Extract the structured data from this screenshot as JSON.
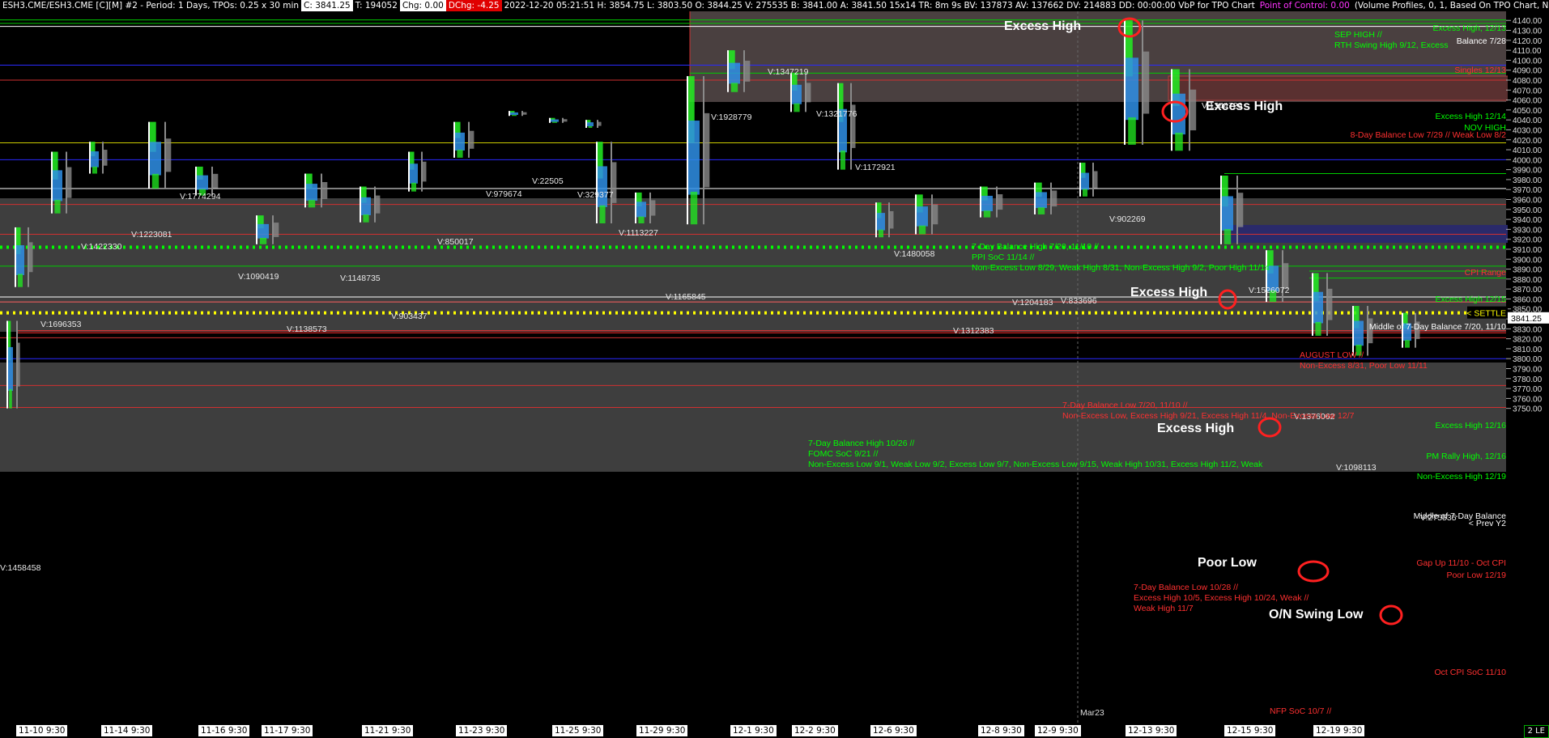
{
  "window_title": "ESH3.CME/ESH3.CME [C][M]",
  "topbar": {
    "items": [
      {
        "text": "ESH3.CME/ESH3.CME [C][M]  #2 - Period: 1 Days, TPOs: 0.25 x 30 min",
        "style": "plain"
      },
      {
        "text": "C: 3841.25",
        "style": "val"
      },
      {
        "text": "T: 194052",
        "style": "plain"
      },
      {
        "text": "Chg: 0.00",
        "style": "val"
      },
      {
        "text": "DChg: -4.25",
        "style": "neg"
      },
      {
        "text": "2022-12-20 05:21:51 H: 3854.75 L: 3803.50 O: 3844.25 V: 275535 B: 3841.00 A: 3841.50 15x14 TR: 8m 9s BV: 137873 AV: 137662 DV: 214883 DD: 00:00:00 VbP for TPO Chart",
        "style": "plain"
      },
      {
        "text": "Point of Control: 0.00",
        "style": "poc"
      },
      {
        "text": "(Volume Profiles, 0, 1, Based On TPO Chart, No, Days, 1, 50, 1",
        "style": "plain"
      }
    ]
  },
  "colors": {
    "background": "#000000",
    "gray_zone": "#3e3e3e",
    "upper_zone": "#4a4040",
    "tpo_green": "#22ee22",
    "tpo_blue": "#2f8fe6",
    "volume_gray": "#8a8a8a",
    "excess_red": "#ff2020",
    "settle_yellow": "#ffff00",
    "dotted_green": "#00ff00",
    "label_green": "#00ff00",
    "label_red": "#ff3030"
  },
  "price_axis": {
    "ticks": [
      4140,
      4130,
      4120,
      4110,
      4100,
      4090,
      4080,
      4070,
      4060,
      4050,
      4040,
      4030,
      4020,
      4010,
      4000,
      3990,
      3980,
      3970,
      3960,
      3950,
      3940,
      3930,
      3920,
      3910,
      3900,
      3890,
      3880,
      3870,
      3860,
      3850,
      3840,
      3830,
      3820,
      3810,
      3800,
      3790,
      3780,
      3770,
      3760,
      3750
    ]
  },
  "date_axis": {
    "labels": [
      "11-10  9:30",
      "11-14  9:30",
      "11-16  9:30",
      "11-17  9:30",
      "11-21  9:30",
      "11-23  9:30",
      "11-25  9:30",
      "11-29  9:30",
      "12-1  9:30",
      "12-2  9:30",
      "12-6  9:30",
      "12-8  9:30",
      "12-9  9:30",
      "12-13  9:30",
      "12-15  9:30",
      "12-19  9:30"
    ]
  },
  "corner_label": "2 LE",
  "contract_roll_label": "Mar23",
  "last_price_tag": "3841.25",
  "settle_tag": "< SETTLE",
  "volume_labels": [
    "V:1696353",
    "V:1422330",
    "V:1223081",
    "V:1774294",
    "V:1090419",
    "V:1138573",
    "V:1148735",
    "V:903437",
    "V:850017",
    "V:979674",
    "V:22505",
    "V:329377",
    "V:1113227",
    "V:1165845",
    "V:1928779",
    "V:1347219",
    "V:1321776",
    "V:1172921",
    "V:1480058",
    "V:1312383",
    "V:1204183",
    "V:833696",
    "V:902269",
    "V:1344726",
    "V:1526072",
    "V:1376062",
    "V:1098113",
    "V:275535",
    "V:1458458"
  ],
  "annotations": [
    {
      "text": "Excess High",
      "kind": "white_big"
    },
    {
      "text": "Excess High",
      "kind": "white_big"
    },
    {
      "text": "Excess High",
      "kind": "white_big"
    },
    {
      "text": "Excess High",
      "kind": "white_big"
    },
    {
      "text": "Poor Low",
      "kind": "white_big"
    },
    {
      "text": "O/N Swing Low",
      "kind": "white_big"
    }
  ],
  "level_labels": [
    {
      "text": "Excess High, 12/13",
      "color": "green"
    },
    {
      "text": "SEP HIGH //",
      "color": "green"
    },
    {
      "text": "RTH Swing High 9/12, Excess",
      "color": "green"
    },
    {
      "text": "Balance 7/28",
      "color": "white"
    },
    {
      "text": "Singles 12/13",
      "color": "red"
    },
    {
      "text": "Excess High 12/14",
      "color": "green"
    },
    {
      "text": "NOV HIGH",
      "color": "green"
    },
    {
      "text": "8-Day Balance Low 7/29 // Weak Low 8/2",
      "color": "red"
    },
    {
      "text": "7-Day Balance High 7/20, 11/10 //",
      "color": "green"
    },
    {
      "text": "PPI SoC 11/14 //",
      "color": "green"
    },
    {
      "text": "Non-Excess Low 8/29, Weak High 8/31, Non-Excess High 9/2, Poor High 11/14",
      "color": "green"
    },
    {
      "text": "CPI Range",
      "color": "red"
    },
    {
      "text": "Excess High 12/15",
      "color": "green"
    },
    {
      "text": "Middle of 7-Day Balance 7/20, 11/10",
      "color": "white"
    },
    {
      "text": "AUGUST LOW //",
      "color": "red"
    },
    {
      "text": "Non-Excess 8/31, Poor Low 11/11",
      "color": "red"
    },
    {
      "text": "7-Day Balance Low 7/20, 11/10 //",
      "color": "red"
    },
    {
      "text": "Non-Excess Low, Excess High 9/21, Excess High 11/4, Non-Excess Low 12/7",
      "color": "red"
    },
    {
      "text": "Excess High 12/16",
      "color": "green"
    },
    {
      "text": "7-Day Balance High 10/26 //",
      "color": "green"
    },
    {
      "text": "FOMC SoC 9/21 //",
      "color": "green"
    },
    {
      "text": "Non-Excess Low 9/1, Weak Low 9/2, Excess Low 9/7, Non-Excess Low 9/15, Weak High 10/31, Excess High 11/2, Weak",
      "color": "green"
    },
    {
      "text": "PM Rally High, 12/16",
      "color": "green"
    },
    {
      "text": "Non-Excess High 12/19",
      "color": "green"
    },
    {
      "text": "Middle of 7-Day Balance",
      "color": "white"
    },
    {
      "text": "< Prev Y2",
      "color": "white"
    },
    {
      "text": "Gap Up 11/10 - Oct CPI",
      "color": "red"
    },
    {
      "text": "Poor Low 12/19",
      "color": "red"
    },
    {
      "text": "7-Day Balance Low 10/28 //",
      "color": "red"
    },
    {
      "text": "Excess High 10/5, Excess High 10/24, Weak //",
      "color": "red"
    },
    {
      "text": "Weak High 11/7",
      "color": "red"
    },
    {
      "text": "Oct CPI SoC 11/10",
      "color": "red"
    },
    {
      "text": "NFP SoC 10/7 //",
      "color": "red"
    }
  ]
}
